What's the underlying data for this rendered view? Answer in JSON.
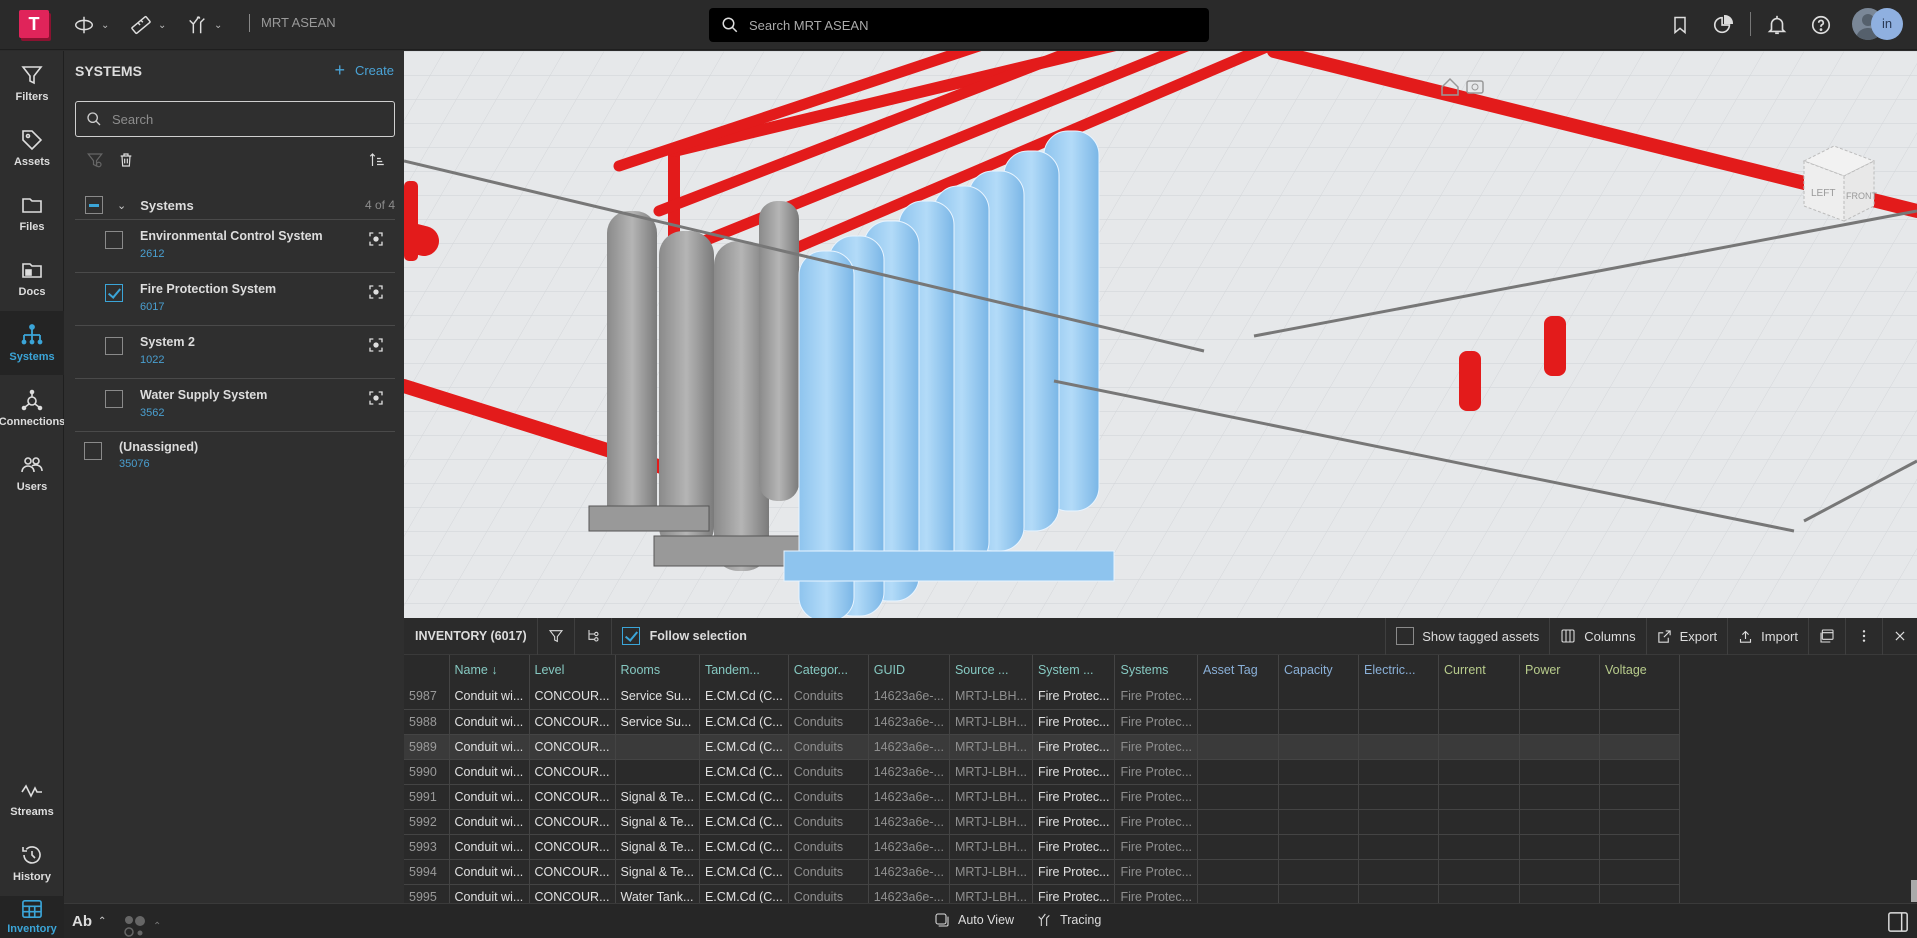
{
  "app": {
    "logo_letter": "T",
    "project_name": "MRT ASEAN",
    "search_placeholder": "Search MRT ASEAN",
    "toolbar": [
      "orbit-tool",
      "measure-tool",
      "trace-tool"
    ],
    "header_icons": [
      "bookmark-icon",
      "chart-icon",
      "notification-bell-icon",
      "help-icon"
    ],
    "user_initials": "in"
  },
  "nav": {
    "items": [
      {
        "label": "Filters",
        "icon": "filter-icon"
      },
      {
        "label": "Assets",
        "icon": "tag-icon"
      },
      {
        "label": "Files",
        "icon": "folder-icon"
      },
      {
        "label": "Docs",
        "icon": "docs-folder-icon"
      },
      {
        "label": "Systems",
        "icon": "systems-tree-icon",
        "active": true
      },
      {
        "label": "Connections",
        "icon": "connections-icon"
      },
      {
        "label": "Users",
        "icon": "users-icon"
      },
      {
        "label": "Streams",
        "icon": "streams-icon"
      },
      {
        "label": "History",
        "icon": "history-icon"
      },
      {
        "label": "Inventory",
        "icon": "table-icon",
        "active": true
      }
    ]
  },
  "systems_panel": {
    "title": "SYSTEMS",
    "create_label": "Create",
    "search_placeholder": "Search",
    "group": {
      "label": "Systems",
      "count": "4 of 4"
    },
    "systems": [
      {
        "name": "Environmental Control System",
        "count": "2612",
        "checked": false
      },
      {
        "name": "Fire Protection System",
        "count": "6017",
        "checked": true
      },
      {
        "name": "System 2",
        "count": "1022",
        "checked": false
      },
      {
        "name": "Water Supply System",
        "count": "3562",
        "checked": false
      }
    ],
    "unassigned": {
      "name": "(Unassigned)",
      "count": "35076"
    }
  },
  "viewcube": {
    "left": "LEFT",
    "front": "FRONT"
  },
  "inventory": {
    "title": "INVENTORY (6017)",
    "follow_selection_label": "Follow selection",
    "follow_selection_checked": true,
    "show_tagged_label": "Show tagged assets",
    "show_tagged_checked": false,
    "columns_label": "Columns",
    "export_label": "Export",
    "import_label": "Import",
    "columns": [
      {
        "label": "",
        "color": "teal"
      },
      {
        "label": "Name ↓",
        "color": "teal"
      },
      {
        "label": "Level",
        "color": "teal"
      },
      {
        "label": "Rooms",
        "color": "teal"
      },
      {
        "label": "Tandem...",
        "color": "teal"
      },
      {
        "label": "Categor...",
        "color": "teal"
      },
      {
        "label": "GUID",
        "color": "teal"
      },
      {
        "label": "Source ...",
        "color": "teal"
      },
      {
        "label": "System ...",
        "color": "teal"
      },
      {
        "label": "Systems",
        "color": "teal"
      },
      {
        "label": "Asset Tag",
        "color": "blue"
      },
      {
        "label": "Capacity",
        "color": "blue"
      },
      {
        "label": "Electric...",
        "color": "blue"
      },
      {
        "label": "Current",
        "color": "green"
      },
      {
        "label": "Power",
        "color": "green"
      },
      {
        "label": "Voltage",
        "color": "green"
      }
    ],
    "rows": [
      {
        "idx": "5987",
        "name": "Conduit wi...",
        "level": "CONCOUR...",
        "rooms": "Service Su...",
        "tandem": "E.CM.Cd (C...",
        "category": "Conduits",
        "guid": "14623a6e-...",
        "source": "MRTJ-LBH...",
        "system": "Fire Protec...",
        "systems": "Fire Protec..."
      },
      {
        "idx": "5988",
        "name": "Conduit wi...",
        "level": "CONCOUR...",
        "rooms": "Service Su...",
        "tandem": "E.CM.Cd (C...",
        "category": "Conduits",
        "guid": "14623a6e-...",
        "source": "MRTJ-LBH...",
        "system": "Fire Protec...",
        "systems": "Fire Protec..."
      },
      {
        "idx": "5989",
        "name": "Conduit wi...",
        "level": "CONCOUR...",
        "rooms": "",
        "tandem": "E.CM.Cd (C...",
        "category": "Conduits",
        "guid": "14623a6e-...",
        "source": "MRTJ-LBH...",
        "system": "Fire Protec...",
        "systems": "Fire Protec...",
        "highlight": true
      },
      {
        "idx": "5990",
        "name": "Conduit wi...",
        "level": "CONCOUR...",
        "rooms": "",
        "tandem": "E.CM.Cd (C...",
        "category": "Conduits",
        "guid": "14623a6e-...",
        "source": "MRTJ-LBH...",
        "system": "Fire Protec...",
        "systems": "Fire Protec..."
      },
      {
        "idx": "5991",
        "name": "Conduit wi...",
        "level": "CONCOUR...",
        "rooms": "Signal & Te...",
        "tandem": "E.CM.Cd (C...",
        "category": "Conduits",
        "guid": "14623a6e-...",
        "source": "MRTJ-LBH...",
        "system": "Fire Protec...",
        "systems": "Fire Protec..."
      },
      {
        "idx": "5992",
        "name": "Conduit wi...",
        "level": "CONCOUR...",
        "rooms": "Signal & Te...",
        "tandem": "E.CM.Cd (C...",
        "category": "Conduits",
        "guid": "14623a6e-...",
        "source": "MRTJ-LBH...",
        "system": "Fire Protec...",
        "systems": "Fire Protec..."
      },
      {
        "idx": "5993",
        "name": "Conduit wi...",
        "level": "CONCOUR...",
        "rooms": "Signal & Te...",
        "tandem": "E.CM.Cd (C...",
        "category": "Conduits",
        "guid": "14623a6e-...",
        "source": "MRTJ-LBH...",
        "system": "Fire Protec...",
        "systems": "Fire Protec..."
      },
      {
        "idx": "5994",
        "name": "Conduit wi...",
        "level": "CONCOUR...",
        "rooms": "Signal & Te...",
        "tandem": "E.CM.Cd (C...",
        "category": "Conduits",
        "guid": "14623a6e-...",
        "source": "MRTJ-LBH...",
        "system": "Fire Protec...",
        "systems": "Fire Protec..."
      },
      {
        "idx": "5995",
        "name": "Conduit wi...",
        "level": "CONCOUR...",
        "rooms": "Water Tank...",
        "tandem": "E.CM.Cd (C...",
        "category": "Conduits",
        "guid": "14623a6e-...",
        "source": "MRTJ-LBH...",
        "system": "Fire Protec...",
        "systems": "Fire Protec..."
      }
    ]
  },
  "bottom": {
    "text_style_label": "Ab",
    "auto_view_label": "Auto View",
    "tracing_label": "Tracing"
  }
}
